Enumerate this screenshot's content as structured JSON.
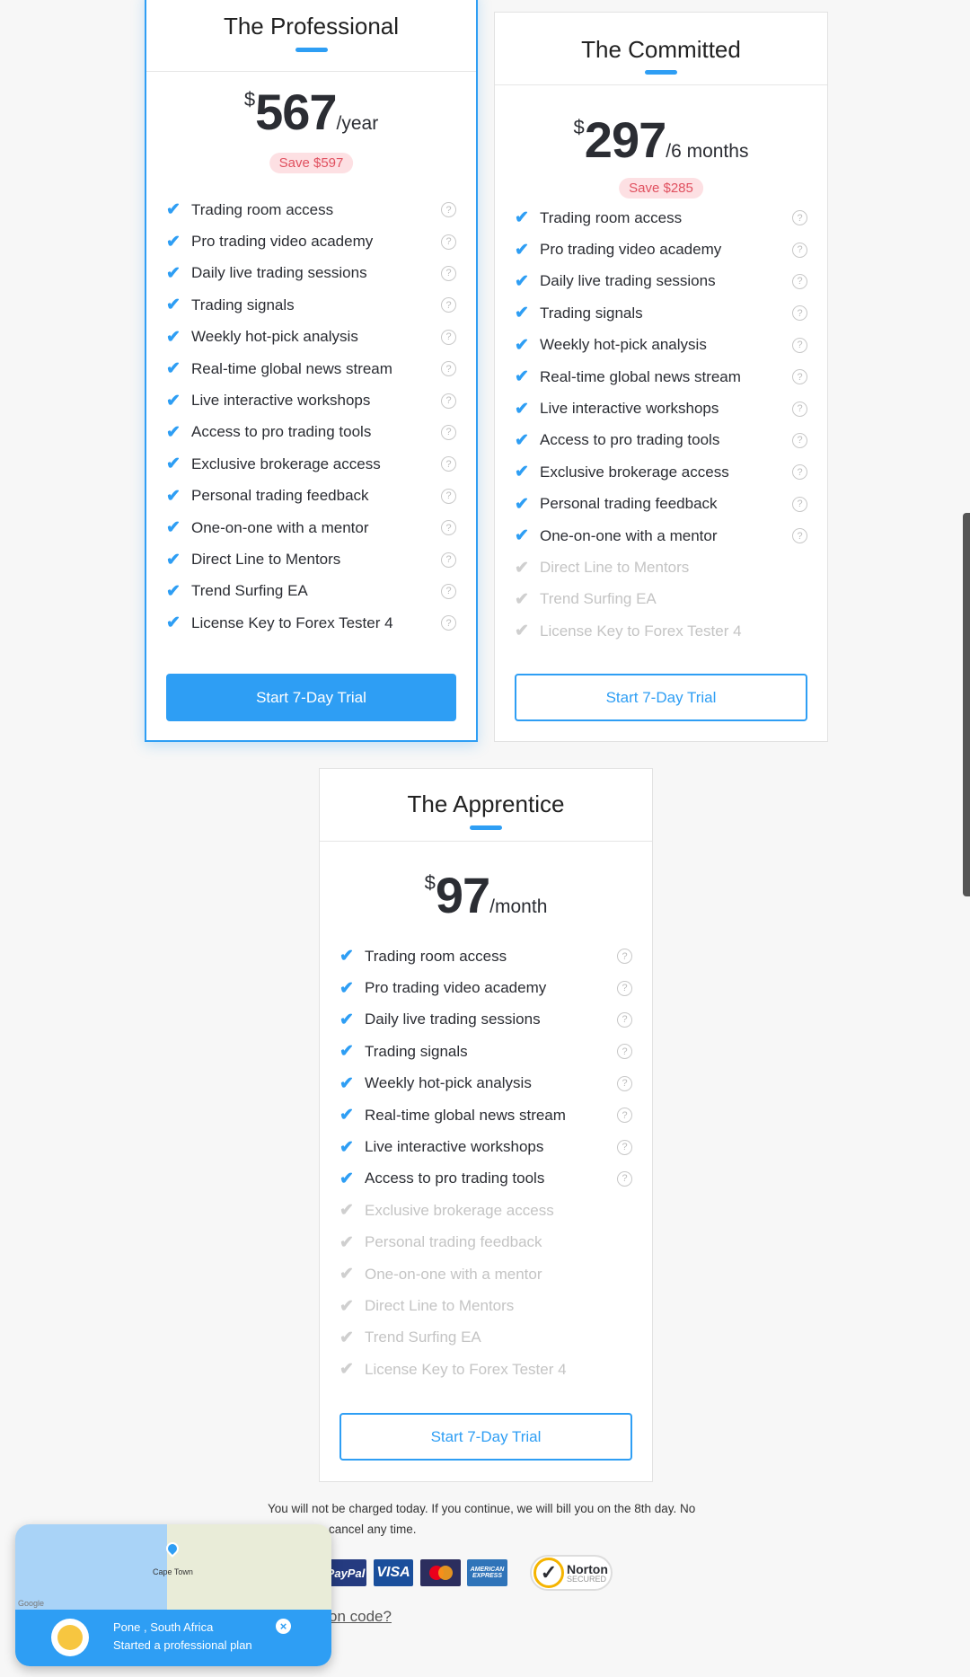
{
  "plans": [
    {
      "id": "professional",
      "title": "The Professional",
      "currency": "$",
      "amount": "567",
      "period": "/year",
      "save": "Save $597",
      "button": "Start 7-Day Trial",
      "included": 14
    },
    {
      "id": "committed",
      "title": "The Committed",
      "currency": "$",
      "amount": "297",
      "period": "/6 months",
      "save": "Save $285",
      "button": "Start 7-Day Trial",
      "included": 11
    },
    {
      "id": "apprentice",
      "title": "The Apprentice",
      "currency": "$",
      "amount": "97",
      "period": "/month",
      "save": null,
      "button": "Start 7-Day Trial",
      "included": 8
    }
  ],
  "features": [
    "Trading room access",
    "Pro trading video academy",
    "Daily live trading sessions",
    "Trading signals",
    "Weekly hot-pick analysis",
    "Real-time global news stream",
    "Live interactive workshops",
    "Access to pro trading tools",
    "Exclusive brokerage access",
    "Personal trading feedback",
    "One-on-one with a mentor",
    "Direct Line to Mentors",
    "Trend Surfing EA",
    "License Key to Forex Tester 4"
  ],
  "footer": {
    "notice_line1": "You will not be charged today. If you continue, we will bill you on the 8th day. No",
    "notice_line2": "cancel any time.",
    "promo": "on code?"
  },
  "payments": {
    "paypal": "PayPal",
    "visa": "VISA",
    "amex": "AMERICAN EXPRESS",
    "norton": "Norton",
    "norton_sub": "SECURED"
  },
  "popup": {
    "location": "Pone , South Africa",
    "message": "Started a professional plan",
    "map_city": "Cape Town",
    "map_credit": "Google"
  },
  "colors": {
    "accent": "#2e9ef4",
    "save_bg": "#fde0e3",
    "save_text": "#e0505f"
  }
}
